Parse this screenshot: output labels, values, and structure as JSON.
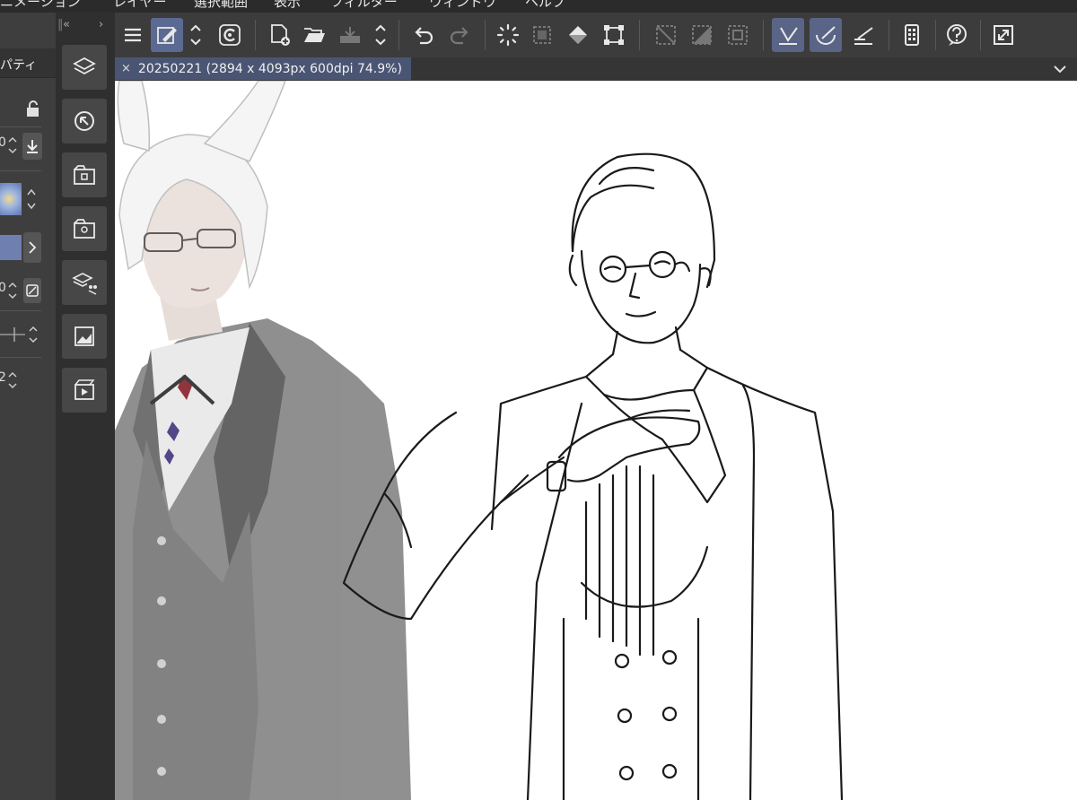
{
  "menu": {
    "items": [
      "ニメーション",
      "レイヤー",
      "選択範囲",
      "表示",
      "フィルター",
      "ウィンドウ",
      "ヘルプ"
    ]
  },
  "left_panel": {
    "tab_label": "パティ",
    "values": [
      "0",
      "0",
      "2"
    ]
  },
  "icon_column": {
    "collapse_left": "«",
    "collapse_right": "›",
    "buttons": [
      "layer-icon",
      "navigator-icon",
      "material-icon",
      "sub-view-icon",
      "layer-property-icon",
      "color-history-icon",
      "animation-timeline-icon"
    ]
  },
  "command_bar": {
    "icons": [
      "menu-icon",
      "brush-tool-icon",
      "stepper-icon",
      "clip-studio-icon",
      "new-file-icon",
      "open-folder-icon",
      "save-icon",
      "stepper-icon",
      "undo-icon",
      "redo-icon",
      "lasso-deselect-icon",
      "select-all-icon",
      "fill-icon",
      "transform-icon",
      "clear-icon",
      "invert-selection-icon",
      "selection-border-icon",
      "snap-ruler-icon",
      "snap-special-ruler-icon",
      "snap-grid-icon",
      "device-settings-icon",
      "help-icon",
      "fullscreen-icon"
    ]
  },
  "document": {
    "tab_title": "20250221 (2894 x 4093px 600dpi 74.9%)",
    "close_glyph": "×",
    "chevron_glyph": "⌄"
  },
  "colors": {
    "accent": "#5b6a92",
    "tab_active": "#4a5574",
    "panel_bg": "#3c3c3c",
    "canvas_bg": "#ffffff"
  }
}
